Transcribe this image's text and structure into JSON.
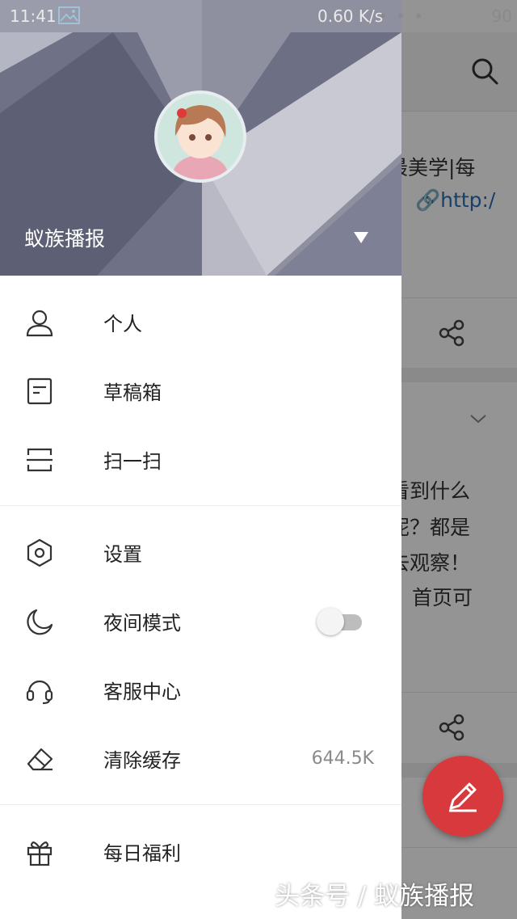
{
  "status_bar": {
    "time": "11:41",
    "speed": "0.60 K/s",
    "dots": "• • •",
    "battery": "90"
  },
  "background_page": {
    "line1": "最美学|每",
    "line2_link": "http:/",
    "line3": "看到什么",
    "line4": "呢？都是",
    "line5": "去观察！",
    "line6": "首页可",
    "fab_icon": "pencil-icon"
  },
  "drawer": {
    "username": "蚁族播报",
    "items_group1": [
      {
        "label": "个人",
        "icon": "user-icon"
      },
      {
        "label": "草稿箱",
        "icon": "draft-icon"
      },
      {
        "label": "扫一扫",
        "icon": "scan-icon"
      }
    ],
    "items_group2": [
      {
        "label": "设置",
        "icon": "settings-hexagon-icon"
      },
      {
        "label": "夜间模式",
        "icon": "moon-icon",
        "toggle": false
      },
      {
        "label": "客服中心",
        "icon": "headset-icon"
      },
      {
        "label": "清除缓存",
        "icon": "eraser-icon",
        "value": "644.5K"
      }
    ],
    "items_group3": [
      {
        "label": "每日福利",
        "icon": "gift-icon"
      }
    ]
  },
  "watermark": "头条号 / 蚁族播报",
  "colors": {
    "accent_fab": "#d8393c",
    "header_bg": "#8d8e9e",
    "link": "#2a6fb8"
  }
}
